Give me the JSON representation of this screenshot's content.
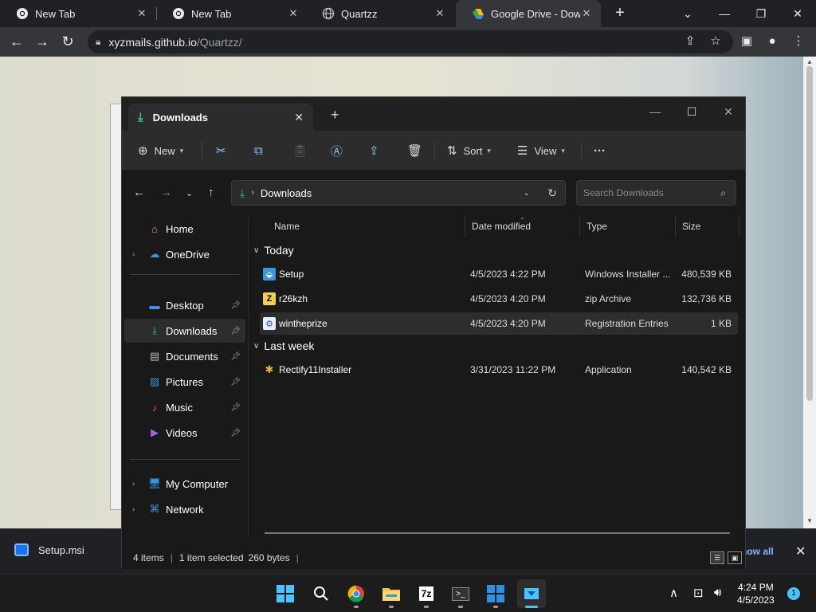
{
  "browser": {
    "tabs": [
      {
        "title": "New Tab",
        "favicon": "chrome-icon",
        "active": false
      },
      {
        "title": "New Tab",
        "favicon": "chrome-icon",
        "active": false
      },
      {
        "title": "Quartzz",
        "favicon": "globe-icon",
        "active": true
      },
      {
        "title": "Google Drive - Downlo",
        "favicon": "google-drive-icon",
        "active": false
      }
    ],
    "url_host": "xyzmails.github.io",
    "url_path": "/Quartzz/"
  },
  "download_bar": {
    "file": "Setup.msi",
    "show_all": "how all"
  },
  "explorer": {
    "tab_title": "Downloads",
    "toolbar": {
      "new_label": "New",
      "sort_label": "Sort",
      "view_label": "View",
      "more_label": "···"
    },
    "address": {
      "crumb": "Downloads",
      "search_placeholder": "Search Downloads"
    },
    "sidebar": {
      "items": [
        {
          "label": "Home"
        },
        {
          "label": "OneDrive"
        },
        {
          "label": "Desktop"
        },
        {
          "label": "Downloads"
        },
        {
          "label": "Documents"
        },
        {
          "label": "Pictures"
        },
        {
          "label": "Music"
        },
        {
          "label": "Videos"
        },
        {
          "label": "My Computer"
        },
        {
          "label": "Network"
        }
      ]
    },
    "columns": {
      "name": "Name",
      "date": "Date modified",
      "type": "Type",
      "size": "Size"
    },
    "groups": {
      "today": {
        "label": "Today",
        "files": [
          {
            "name": "Setup",
            "date": "4/5/2023 4:22 PM",
            "type": "Windows Installer ...",
            "size": "480,539 KB"
          },
          {
            "name": "r26kzh",
            "date": "4/5/2023 4:20 PM",
            "type": "zip Archive",
            "size": "132,736 KB"
          },
          {
            "name": "wintheprize",
            "date": "4/5/2023 4:20 PM",
            "type": "Registration Entries",
            "size": "1 KB"
          }
        ]
      },
      "last_week": {
        "label": "Last week",
        "files": [
          {
            "name": "Rectify11Installer",
            "date": "3/31/2023 11:22 PM",
            "type": "Application",
            "size": "140,542 KB"
          }
        ]
      }
    },
    "status": {
      "items": "4 items",
      "selected": "1 item selected",
      "size": "260 bytes"
    }
  },
  "taskbar": {
    "time": "4:24 PM",
    "date": "4/5/2023",
    "notifications": "1"
  },
  "colors": {
    "accent": "#4cc2ff",
    "explorer_bg": "#191919",
    "chrome_dark": "#202124",
    "downloads_green": "#3ec28f"
  }
}
